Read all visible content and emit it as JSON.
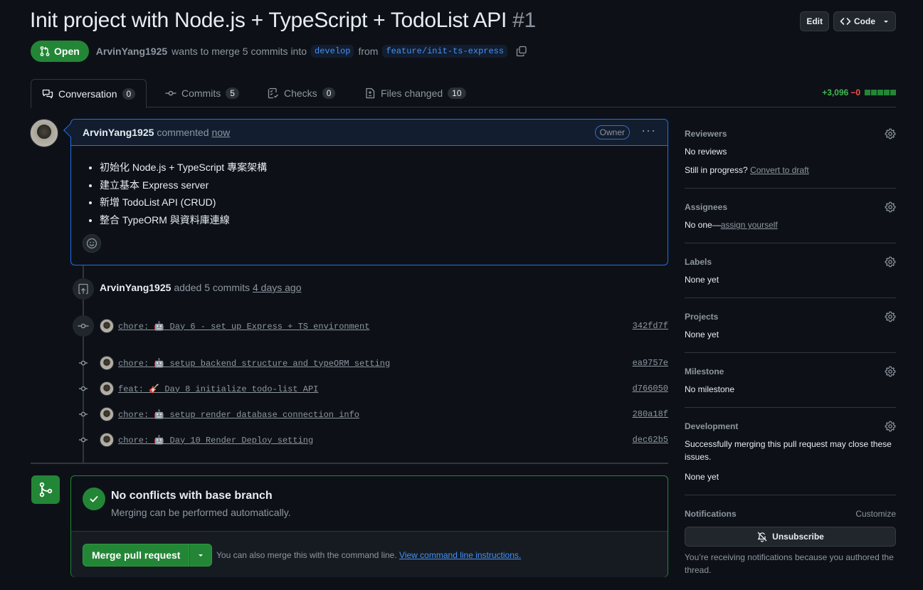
{
  "header": {
    "title": "Init project with Node.js + TypeScript + TodoList API",
    "number": "#1",
    "edit_label": "Edit",
    "code_label": "Code"
  },
  "meta": {
    "state": "Open",
    "author": "ArvinYang1925",
    "merge_text_1": "wants to merge 5 commits into",
    "base_branch": "develop",
    "from_text": "from",
    "head_branch": "feature/init-ts-express"
  },
  "tabs": [
    {
      "label": "Conversation",
      "count": "0"
    },
    {
      "label": "Commits",
      "count": "5"
    },
    {
      "label": "Checks",
      "count": "0"
    },
    {
      "label": "Files changed",
      "count": "10"
    }
  ],
  "diffstat": {
    "additions": "+3,096",
    "deletions": "−0"
  },
  "comment": {
    "author": "ArvinYang1925",
    "action": "commented",
    "time": "now",
    "badge": "Owner",
    "items": [
      "初始化 Node.js + TypeScript 專案架構",
      "建立基本 Express server",
      "新增 TodoList API (CRUD)",
      "整合 TypeORM 與資料庫連線"
    ]
  },
  "commits_event": {
    "user": "ArvinYang1925",
    "action": "added 5 commits",
    "time": "4 days ago"
  },
  "commits": [
    {
      "message": "chore: 🤖 Day 6 - set up Express + TS environment",
      "sha": "342fd7f"
    },
    {
      "message": "chore: 🤖 setup backend structure and typeORM setting",
      "sha": "ea9757e"
    },
    {
      "message": "feat: 🎸 Day 8 initialize todo-list API",
      "sha": "d766050"
    },
    {
      "message": "chore: 🤖 setup render database connection info",
      "sha": "280a18f"
    },
    {
      "message": "chore: 🤖 Day 10 Render Deploy setting",
      "sha": "dec62b5"
    }
  ],
  "merge": {
    "title": "No conflicts with base branch",
    "subtitle": "Merging can be performed automatically.",
    "button": "Merge pull request",
    "hint": "You can also merge this with the command line.",
    "hint_link": "View command line instructions."
  },
  "sidebar": {
    "reviewers": {
      "title": "Reviewers",
      "value": "No reviews",
      "progress_text": "Still in progress?",
      "progress_link": "Convert to draft"
    },
    "assignees": {
      "title": "Assignees",
      "value": "No one—",
      "link": "assign yourself"
    },
    "labels": {
      "title": "Labels",
      "value": "None yet"
    },
    "projects": {
      "title": "Projects",
      "value": "None yet"
    },
    "milestone": {
      "title": "Milestone",
      "value": "No milestone"
    },
    "development": {
      "title": "Development",
      "text": "Successfully merging this pull request may close these issues.",
      "value": "None yet"
    },
    "notifications": {
      "title": "Notifications",
      "customize": "Customize",
      "button": "Unsubscribe",
      "note": "You’re receiving notifications because you authored the thread."
    }
  },
  "colors": {
    "accent_green": "#238636",
    "link_blue": "#4493f8",
    "bg": "#0d1117"
  }
}
